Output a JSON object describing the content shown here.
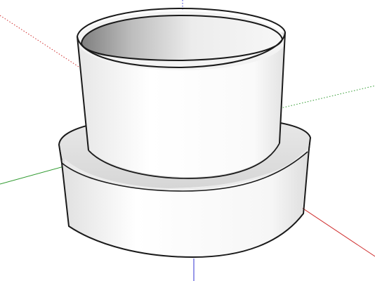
{
  "viewport": {
    "background": "#ffffff"
  },
  "axes": {
    "red_axis_color": "#d03030",
    "green_axis_color": "#2f9a2f",
    "blue_axis_color": "#3030d0"
  },
  "model": {
    "description_icon": "3d-model-icon",
    "body_color": "#ffffff",
    "shadow_color": "#c9c9c9",
    "edge_color": "#1a1a1a"
  }
}
